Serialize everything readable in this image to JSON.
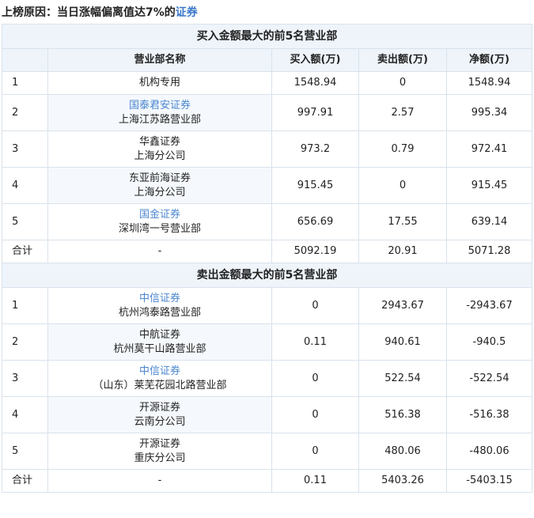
{
  "reason": {
    "label": "上榜原因：",
    "text": "当日涨幅偏离值达7%的",
    "link": "证券"
  },
  "headers": [
    "营业部名称",
    "买入额(万)",
    "卖出额(万)",
    "净额(万)"
  ],
  "buy": {
    "title": "买入金额最大的前5名营业部",
    "rows": [
      {
        "rank": "1",
        "line1": "机构专用",
        "line2": "",
        "line1_link": false,
        "buy": "1548.94",
        "sell": "0",
        "net": "1548.94"
      },
      {
        "rank": "2",
        "line1": "国泰君安证券",
        "line2": "上海江苏路营业部",
        "line1_link": true,
        "buy": "997.91",
        "sell": "2.57",
        "net": "995.34"
      },
      {
        "rank": "3",
        "line1": "华鑫证券",
        "line2": "上海分公司",
        "line1_link": false,
        "buy": "973.2",
        "sell": "0.79",
        "net": "972.41"
      },
      {
        "rank": "4",
        "line1": "东亚前海证券",
        "line2": "上海分公司",
        "line1_link": false,
        "buy": "915.45",
        "sell": "0",
        "net": "915.45"
      },
      {
        "rank": "5",
        "line1": "国金证券",
        "line2": "深圳湾一号营业部",
        "line1_link": true,
        "buy": "656.69",
        "sell": "17.55",
        "net": "639.14"
      }
    ],
    "total": {
      "label": "合计",
      "name": "-",
      "buy": "5092.19",
      "sell": "20.91",
      "net": "5071.28"
    }
  },
  "sell": {
    "title": "卖出金额最大的前5名营业部",
    "rows": [
      {
        "rank": "1",
        "line1": "中信证券",
        "line2": "杭州鸿泰路营业部",
        "line1_link": true,
        "buy": "0",
        "sell": "2943.67",
        "net": "-2943.67"
      },
      {
        "rank": "2",
        "line1": "中航证券",
        "line2": "杭州莫干山路营业部",
        "line1_link": false,
        "buy": "0.11",
        "sell": "940.61",
        "net": "-940.5"
      },
      {
        "rank": "3",
        "line1": "中信证券",
        "line2": "（山东）莱芜花园北路营业部",
        "line1_link": true,
        "buy": "0",
        "sell": "522.54",
        "net": "-522.54"
      },
      {
        "rank": "4",
        "line1": "开源证券",
        "line2": "云南分公司",
        "line1_link": false,
        "buy": "0",
        "sell": "516.38",
        "net": "-516.38"
      },
      {
        "rank": "5",
        "line1": "开源证券",
        "line2": "重庆分公司",
        "line1_link": false,
        "buy": "0",
        "sell": "480.06",
        "net": "-480.06"
      }
    ],
    "total": {
      "label": "合计",
      "name": "-",
      "buy": "0.11",
      "sell": "5403.26",
      "net": "-5403.15"
    }
  }
}
